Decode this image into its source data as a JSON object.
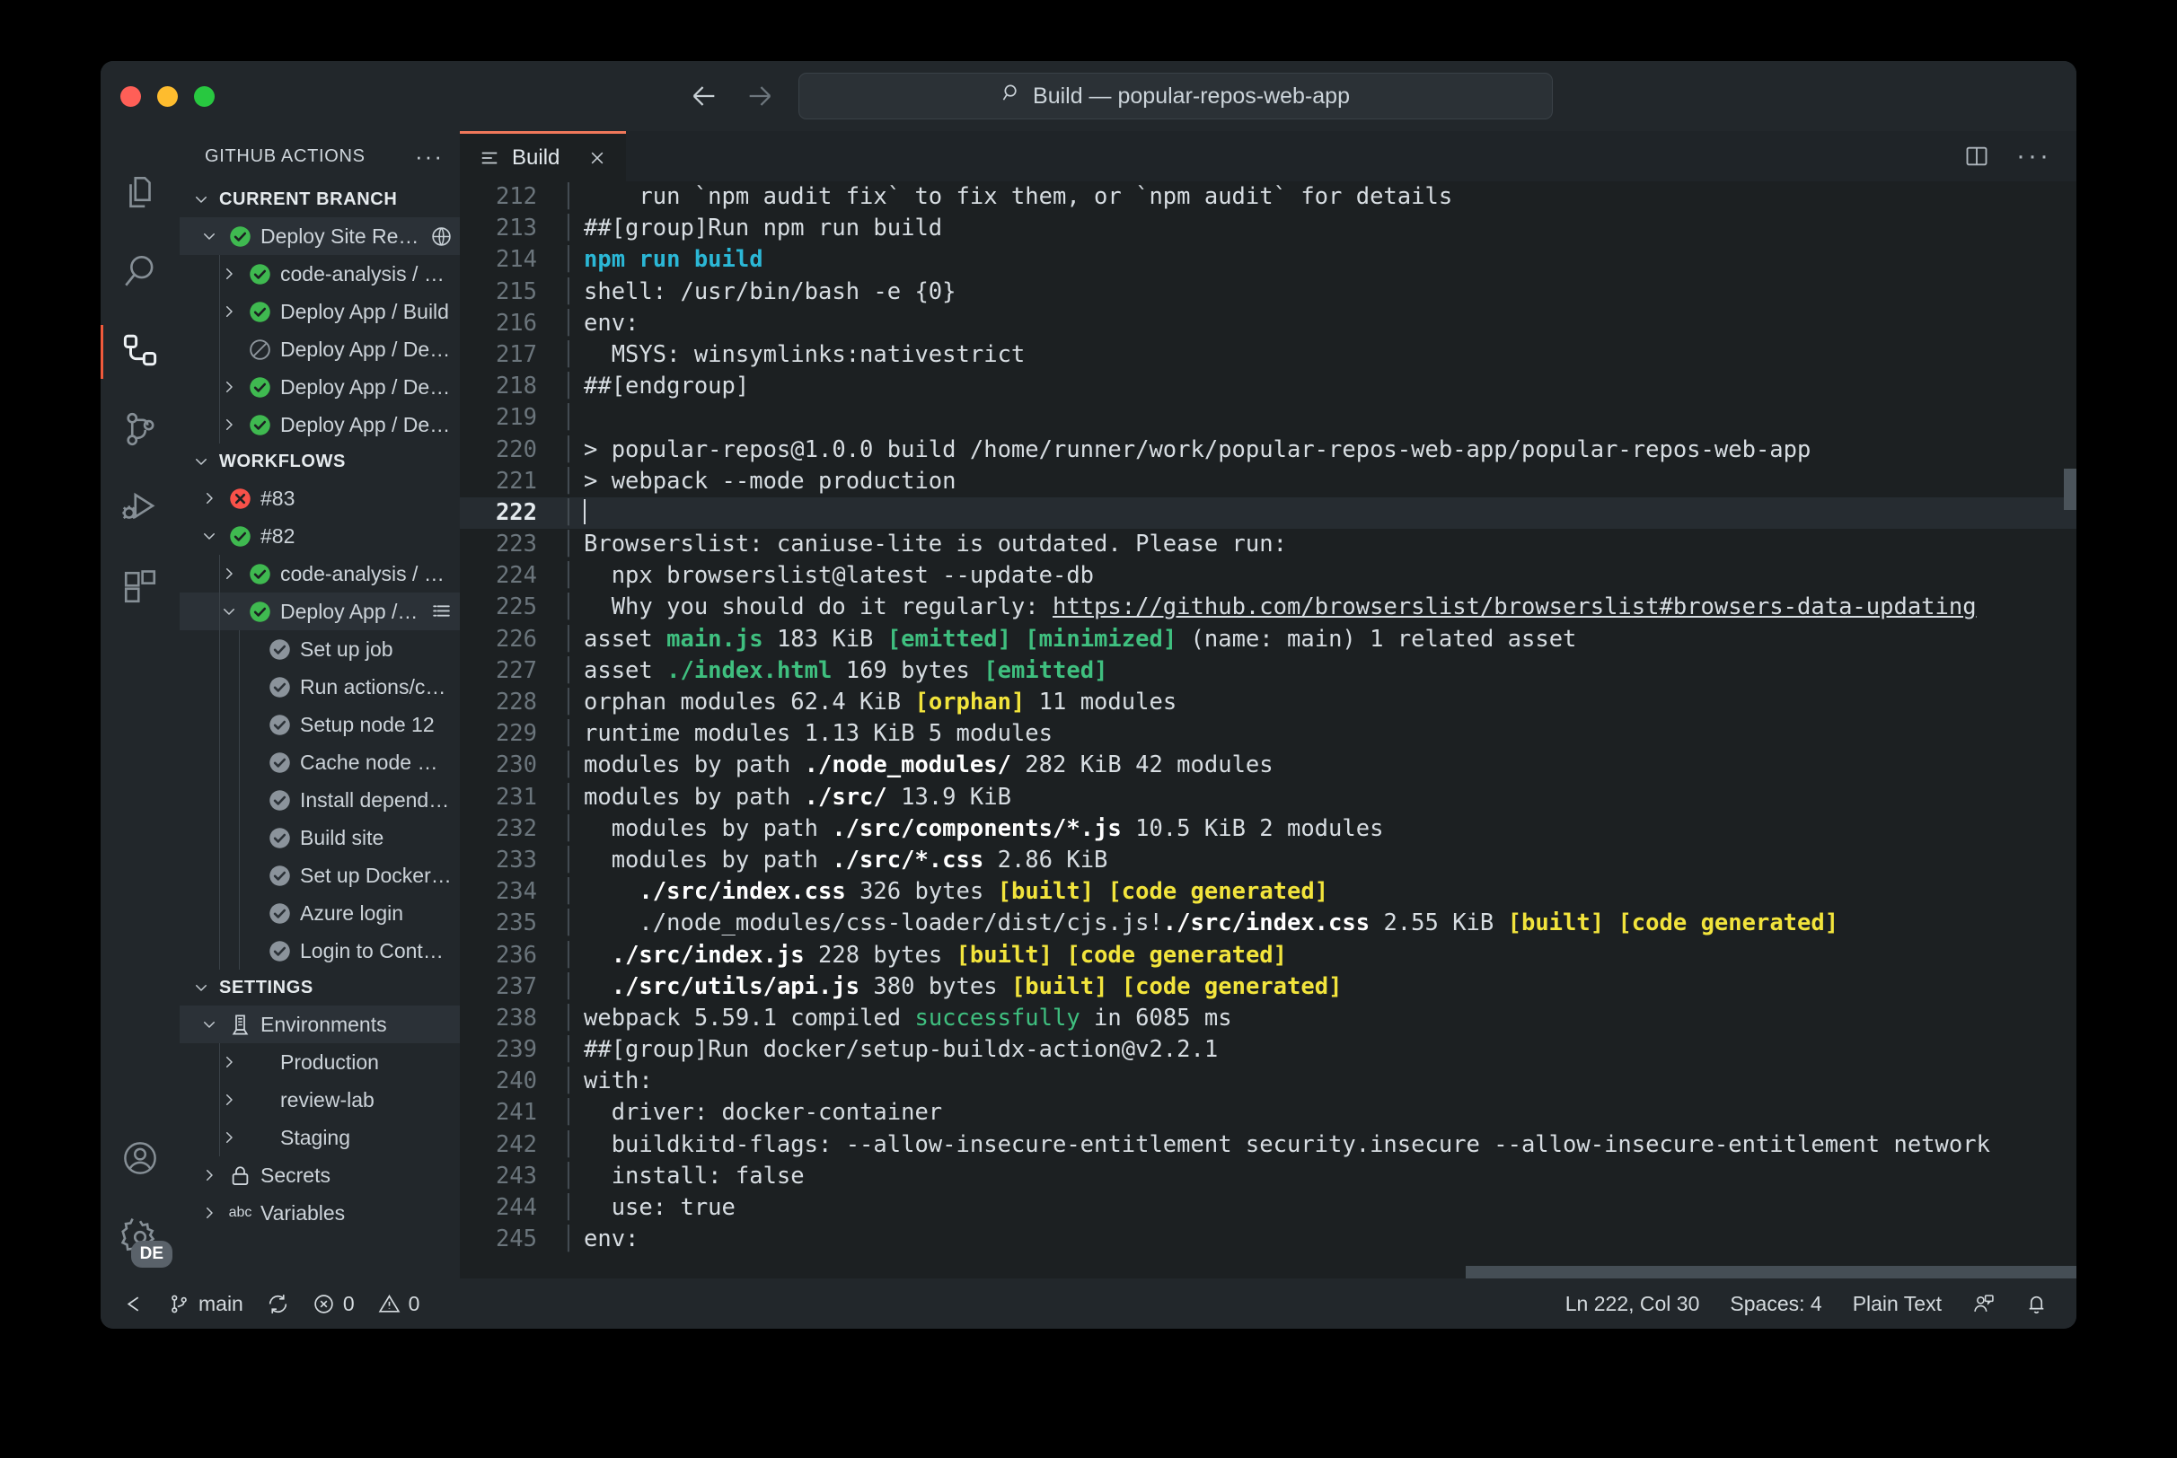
{
  "window": {
    "traffic_lights": [
      "close",
      "minimize",
      "maximize"
    ],
    "omnibox_text": "Build — popular-repos-web-app"
  },
  "activity_bar": {
    "items": [
      {
        "name": "explorer",
        "icon": "files-icon",
        "active": false
      },
      {
        "name": "search",
        "icon": "search-icon",
        "active": false
      },
      {
        "name": "github-actions",
        "icon": "workflow-icon",
        "active": true
      },
      {
        "name": "source-control",
        "icon": "source-control-icon",
        "active": false
      },
      {
        "name": "run-and-debug",
        "icon": "run-debug-icon",
        "active": false
      },
      {
        "name": "extensions",
        "icon": "extensions-icon",
        "active": false
      }
    ],
    "bottom": [
      {
        "name": "accounts",
        "icon": "account-icon"
      },
      {
        "name": "manage",
        "icon": "gear-icon",
        "badge": "DE"
      }
    ]
  },
  "sidebar": {
    "title": "GITHUB ACTIONS",
    "more_label": "···",
    "sections": [
      {
        "title": "CURRENT BRANCH",
        "expanded": true,
        "rows": [
          {
            "label": "Deploy Site Reusable #...",
            "status": "success",
            "twisty": "down",
            "indent": 1,
            "selected": true,
            "trailing": "globe-icon"
          },
          {
            "label": "code-analysis / security c...",
            "status": "success",
            "twisty": "right",
            "indent": 2
          },
          {
            "label": "Deploy App / Build",
            "status": "success",
            "twisty": "right",
            "indent": 2
          },
          {
            "label": "Deploy App / Deploy Revi...",
            "status": "skipped",
            "twisty": "none",
            "indent": 2
          },
          {
            "label": "Deploy App / Deploy Stag...",
            "status": "success",
            "twisty": "right",
            "indent": 2
          },
          {
            "label": "Deploy App / Deploy Prod...",
            "status": "success",
            "twisty": "right",
            "indent": 2
          }
        ]
      },
      {
        "title": "WORKFLOWS",
        "expanded": true,
        "rows": [
          {
            "label": "#83",
            "status": "failure",
            "twisty": "right",
            "indent": 1
          },
          {
            "label": "#82",
            "status": "success",
            "twisty": "down",
            "indent": 1
          },
          {
            "label": "code-analysis / security ...",
            "status": "success",
            "twisty": "right",
            "indent": 2
          },
          {
            "label": "Deploy App / Build",
            "status": "success",
            "twisty": "down",
            "indent": 2,
            "selected": true,
            "trailing": "log-icon"
          },
          {
            "label": "Set up job",
            "status": "step-done",
            "twisty": "none",
            "indent": 3
          },
          {
            "label": "Run actions/checkout...",
            "status": "step-done",
            "twisty": "none",
            "indent": 3
          },
          {
            "label": "Setup node 12",
            "status": "step-done",
            "twisty": "none",
            "indent": 3
          },
          {
            "label": "Cache node modules",
            "status": "step-done",
            "twisty": "none",
            "indent": 3
          },
          {
            "label": "Install dependencies",
            "status": "step-done",
            "twisty": "none",
            "indent": 3
          },
          {
            "label": "Build site",
            "status": "step-done",
            "twisty": "none",
            "indent": 3
          },
          {
            "label": "Set up Docker Buildx",
            "status": "step-done",
            "twisty": "none",
            "indent": 3
          },
          {
            "label": "Azure login",
            "status": "step-done",
            "twisty": "none",
            "indent": 3
          },
          {
            "label": "Login to Container Reg...",
            "status": "step-done",
            "twisty": "none",
            "indent": 3
          }
        ]
      },
      {
        "title": "SETTINGS",
        "expanded": true,
        "rows": [
          {
            "label": "Environments",
            "status": "server",
            "twisty": "down",
            "indent": 1,
            "selected": true
          },
          {
            "label": "Production",
            "status": "none",
            "twisty": "right",
            "indent": 2
          },
          {
            "label": "review-lab",
            "status": "none",
            "twisty": "right",
            "indent": 2
          },
          {
            "label": "Staging",
            "status": "none",
            "twisty": "right",
            "indent": 2
          },
          {
            "label": "Secrets",
            "status": "lock",
            "twisty": "right",
            "indent": 1
          },
          {
            "label": "Variables",
            "status": "abc",
            "twisty": "right",
            "indent": 1
          }
        ]
      }
    ]
  },
  "editor": {
    "tab": {
      "label": "Build",
      "icon": "log-file-icon",
      "close_label": "×"
    },
    "toolbar": {
      "split_icon": "split-editor-icon",
      "more_label": "···"
    },
    "first_line_number": 212,
    "current_line": 222,
    "lines": [
      {
        "n": 212,
        "spans": [
          {
            "t": "    run `npm audit fix` to fix them, or `npm audit` for details"
          }
        ]
      },
      {
        "n": 213,
        "spans": [
          {
            "t": "##[group]Run npm run build"
          }
        ]
      },
      {
        "n": 214,
        "spans": [
          {
            "t": "npm run build",
            "c": "c"
          }
        ]
      },
      {
        "n": 215,
        "spans": [
          {
            "t": "shell: /usr/bin/bash -e {0}"
          }
        ]
      },
      {
        "n": 216,
        "spans": [
          {
            "t": "env:"
          }
        ]
      },
      {
        "n": 217,
        "spans": [
          {
            "t": "  MSYS: winsymlinks:nativestrict"
          }
        ]
      },
      {
        "n": 218,
        "spans": [
          {
            "t": "##[endgroup]"
          }
        ]
      },
      {
        "n": 219,
        "spans": [
          {
            "t": ""
          }
        ]
      },
      {
        "n": 220,
        "spans": [
          {
            "t": "> popular-repos@1.0.0 build /home/runner/work/popular-repos-web-app/popular-repos-web-app"
          }
        ]
      },
      {
        "n": 221,
        "spans": [
          {
            "t": "> webpack --mode production"
          }
        ]
      },
      {
        "n": 222,
        "spans": [
          {
            "t": "",
            "cursor": true
          }
        ]
      },
      {
        "n": 223,
        "spans": [
          {
            "t": "Browserslist: caniuse-lite is outdated. Please run:"
          }
        ]
      },
      {
        "n": 224,
        "spans": [
          {
            "t": "  npx browserslist@latest --update-db"
          }
        ]
      },
      {
        "n": 225,
        "spans": [
          {
            "t": "  Why you should do it regularly: "
          },
          {
            "t": "https://github.com/browserslist/browserslist#browsers-data-updating",
            "c": "lnk"
          }
        ]
      },
      {
        "n": 226,
        "spans": [
          {
            "t": "asset "
          },
          {
            "t": "main.js",
            "c": "g"
          },
          {
            "t": " 183 KiB "
          },
          {
            "t": "[emitted]",
            "c": "g"
          },
          {
            "t": " "
          },
          {
            "t": "[minimized]",
            "c": "g"
          },
          {
            "t": " (name: main) 1 related asset"
          }
        ]
      },
      {
        "n": 227,
        "spans": [
          {
            "t": "asset "
          },
          {
            "t": "./index.html",
            "c": "g"
          },
          {
            "t": " 169 bytes "
          },
          {
            "t": "[emitted]",
            "c": "g"
          }
        ]
      },
      {
        "n": 228,
        "spans": [
          {
            "t": "orphan modules 62.4 KiB "
          },
          {
            "t": "[orphan]",
            "c": "y"
          },
          {
            "t": " 11 modules"
          }
        ]
      },
      {
        "n": 229,
        "spans": [
          {
            "t": "runtime modules 1.13 KiB 5 modules"
          }
        ]
      },
      {
        "n": 230,
        "spans": [
          {
            "t": "modules by path "
          },
          {
            "t": "./node_modules/",
            "c": "w"
          },
          {
            "t": " 282 KiB 42 modules"
          }
        ]
      },
      {
        "n": 231,
        "spans": [
          {
            "t": "modules by path "
          },
          {
            "t": "./src/",
            "c": "w"
          },
          {
            "t": " 13.9 KiB"
          }
        ]
      },
      {
        "n": 232,
        "spans": [
          {
            "t": "  modules by path "
          },
          {
            "t": "./src/components/*.js",
            "c": "w"
          },
          {
            "t": " 10.5 KiB 2 modules"
          }
        ]
      },
      {
        "n": 233,
        "spans": [
          {
            "t": "  modules by path "
          },
          {
            "t": "./src/*.css",
            "c": "w"
          },
          {
            "t": " 2.86 KiB"
          }
        ]
      },
      {
        "n": 234,
        "spans": [
          {
            "t": "    "
          },
          {
            "t": "./src/index.css",
            "c": "w"
          },
          {
            "t": " 326 bytes "
          },
          {
            "t": "[built]",
            "c": "y"
          },
          {
            "t": " "
          },
          {
            "t": "[code generated]",
            "c": "y"
          }
        ]
      },
      {
        "n": 235,
        "spans": [
          {
            "t": "    ./node_modules/css-loader/dist/cjs.js!"
          },
          {
            "t": "./src/index.css",
            "c": "w"
          },
          {
            "t": " 2.55 KiB "
          },
          {
            "t": "[built]",
            "c": "y"
          },
          {
            "t": " "
          },
          {
            "t": "[code generated]",
            "c": "y"
          }
        ]
      },
      {
        "n": 236,
        "spans": [
          {
            "t": "  "
          },
          {
            "t": "./src/index.js",
            "c": "w"
          },
          {
            "t": " 228 bytes "
          },
          {
            "t": "[built]",
            "c": "y"
          },
          {
            "t": " "
          },
          {
            "t": "[code generated]",
            "c": "y"
          }
        ]
      },
      {
        "n": 237,
        "spans": [
          {
            "t": "  "
          },
          {
            "t": "./src/utils/api.js",
            "c": "w"
          },
          {
            "t": " 380 bytes "
          },
          {
            "t": "[built]",
            "c": "y"
          },
          {
            "t": " "
          },
          {
            "t": "[code generated]",
            "c": "y"
          }
        ]
      },
      {
        "n": 238,
        "spans": [
          {
            "t": "webpack 5.59.1 compiled "
          },
          {
            "t": "successfully",
            "c": "gsoft"
          },
          {
            "t": " in 6085 ms"
          }
        ]
      },
      {
        "n": 239,
        "spans": [
          {
            "t": "##[group]Run docker/setup-buildx-action@v2.2.1"
          }
        ]
      },
      {
        "n": 240,
        "spans": [
          {
            "t": "with:"
          }
        ]
      },
      {
        "n": 241,
        "spans": [
          {
            "t": "  driver: docker-container"
          }
        ]
      },
      {
        "n": 242,
        "spans": [
          {
            "t": "  buildkitd-flags: --allow-insecure-entitlement security.insecure --allow-insecure-entitlement network"
          }
        ]
      },
      {
        "n": 243,
        "spans": [
          {
            "t": "  install: false"
          }
        ]
      },
      {
        "n": 244,
        "spans": [
          {
            "t": "  use: true"
          }
        ]
      },
      {
        "n": 245,
        "spans": [
          {
            "t": "env:"
          }
        ]
      }
    ]
  },
  "status_bar": {
    "left": [
      {
        "name": "remote-indicator",
        "icon": "remote-icon",
        "label": ""
      },
      {
        "name": "branch",
        "icon": "branch-icon",
        "label": "main"
      },
      {
        "name": "sync",
        "icon": "sync-icon",
        "label": ""
      },
      {
        "name": "errors",
        "icon": "error-icon",
        "label": "0"
      },
      {
        "name": "warnings",
        "icon": "warning-icon",
        "label": "0"
      }
    ],
    "right": [
      {
        "name": "cursor-position",
        "label": "Ln 222, Col 30"
      },
      {
        "name": "indentation",
        "label": "Spaces: 4"
      },
      {
        "name": "language-mode",
        "label": "Plain Text"
      },
      {
        "name": "live-share",
        "icon": "live-share-icon",
        "label": ""
      },
      {
        "name": "notifications",
        "icon": "bell-icon",
        "label": ""
      }
    ]
  },
  "colors": {
    "accent": "#f0785a",
    "success": "#3fb950",
    "failure": "#f85149",
    "background": "#1c2022",
    "chrome": "#22272b"
  }
}
